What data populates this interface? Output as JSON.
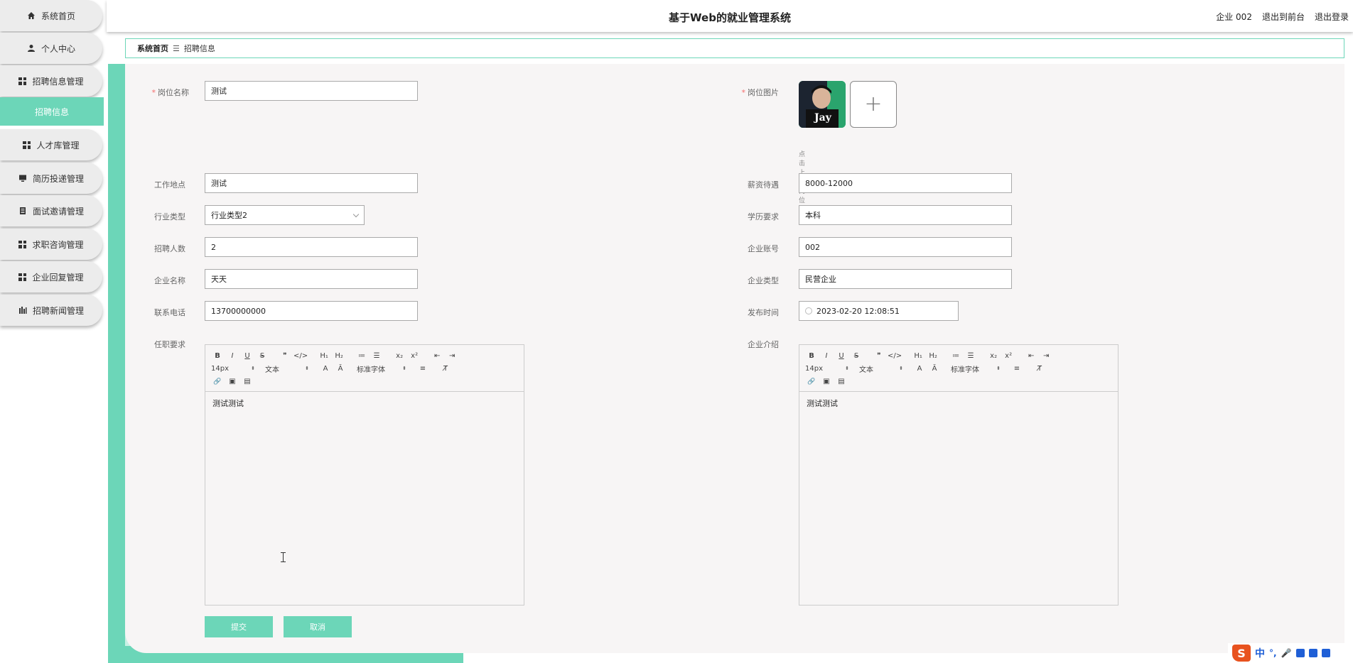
{
  "header": {
    "title": "基于Web的就业管理系统",
    "user": "企业 002",
    "to_front": "退出到前台",
    "logout": "退出登录"
  },
  "sidebar": {
    "items": [
      {
        "label": "系统首页",
        "icon": "home-icon"
      },
      {
        "label": "个人中心",
        "icon": "user-icon"
      },
      {
        "label": "招聘信息管理",
        "icon": "grid-icon"
      },
      {
        "label": "招聘信息",
        "icon": "",
        "active": true
      },
      {
        "label": "人才库管理",
        "icon": "grid-icon"
      },
      {
        "label": "简历投递管理",
        "icon": "monitor-icon"
      },
      {
        "label": "面试邀请管理",
        "icon": "document-icon"
      },
      {
        "label": "求职咨询管理",
        "icon": "grid-icon"
      },
      {
        "label": "企业回复管理",
        "icon": "grid-icon"
      },
      {
        "label": "招聘新闻管理",
        "icon": "bar-chart-icon"
      }
    ]
  },
  "breadcrumb": {
    "home": "系统首页",
    "separator": "☰",
    "current": "招聘信息"
  },
  "form": {
    "job_name": {
      "label": "岗位名称",
      "value": "测试"
    },
    "job_image": {
      "label": "岗位图片",
      "hint": "点击上传岗位图片",
      "thumb_text": "Jay"
    },
    "work_place": {
      "label": "工作地点",
      "value": "测试"
    },
    "salary": {
      "label": "薪资待遇",
      "value": "8000-12000"
    },
    "industry": {
      "label": "行业类型",
      "value": "行业类型2"
    },
    "education": {
      "label": "学历要求",
      "value": "本科"
    },
    "headcount": {
      "label": "招聘人数",
      "value": "2"
    },
    "company_account": {
      "label": "企业账号",
      "value": "002"
    },
    "company_name": {
      "label": "企业名称",
      "value": "天天"
    },
    "company_type": {
      "label": "企业类型",
      "value": "民营企业"
    },
    "phone": {
      "label": "联系电话",
      "value": "13700000000"
    },
    "publish_time": {
      "label": "发布时间",
      "value": "2023-02-20 12:08:51"
    },
    "requirements": {
      "label": "任职要求",
      "content": "测试测试"
    },
    "intro": {
      "label": "企业介绍",
      "content": "测试测试"
    }
  },
  "editor_toolbar": {
    "row1": [
      "B",
      "I",
      "U",
      "S",
      "❞",
      "</>",
      "H₁",
      "H₂",
      "≔",
      "☰",
      "x₂",
      "x²",
      "⇤",
      "⇥"
    ],
    "size": "14px",
    "format": "文本",
    "font": "标准字体",
    "row2_tail": [
      "A",
      "Ā",
      "≡",
      "T̸"
    ],
    "row3": [
      "🔗",
      "▣",
      "▤"
    ]
  },
  "actions": {
    "submit": "提交",
    "cancel": "取消"
  },
  "ime": {
    "logo": "S",
    "lang": "中"
  },
  "colors": {
    "accent": "#6cd6b8",
    "required": "#f56c6c"
  }
}
